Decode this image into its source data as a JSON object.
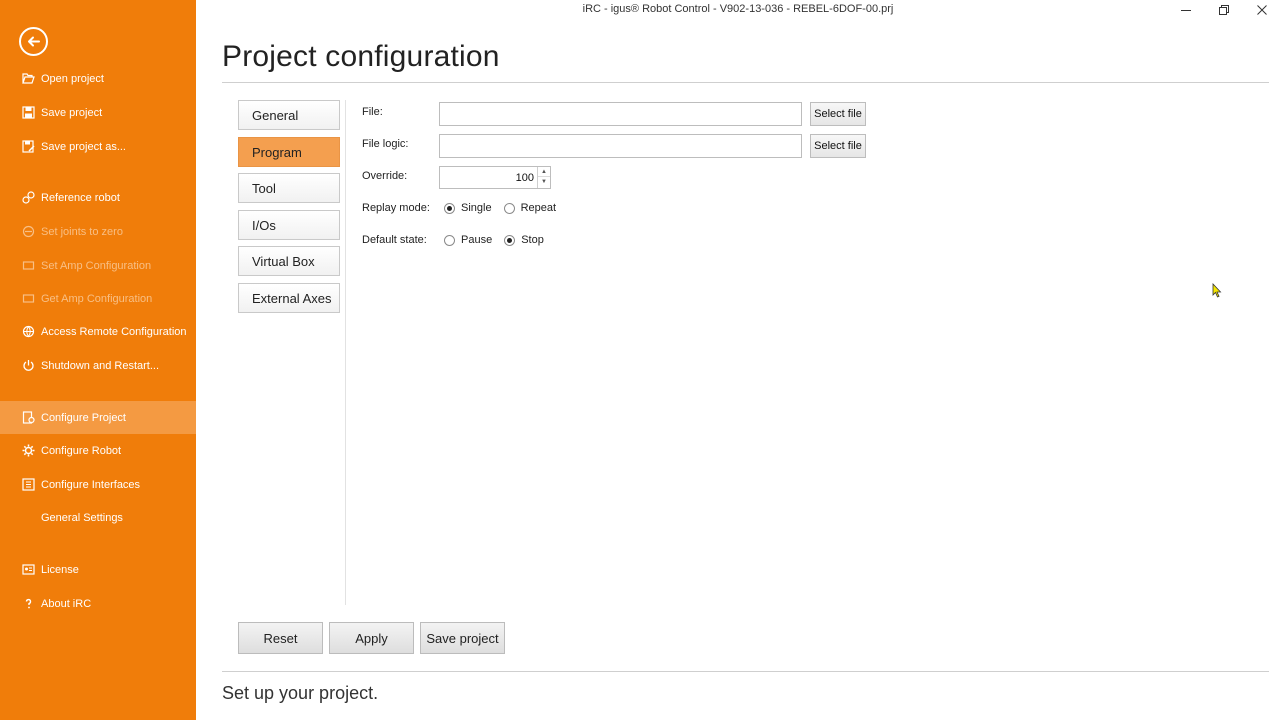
{
  "window": {
    "title": "iRC - igus® Robot Control - V902-13-036 - REBEL-6DOF-00.prj",
    "minimize_icon": "minimize-icon",
    "restore_icon": "restore-icon",
    "close_icon": "close-icon"
  },
  "sidebar": {
    "background": "#f07d0a",
    "back_icon": "back-arrow-icon",
    "items": [
      {
        "label": "Open project",
        "icon": "open-folder-icon",
        "enabled": true
      },
      {
        "label": "Save project",
        "icon": "save-icon",
        "enabled": true
      },
      {
        "label": "Save project as...",
        "icon": "save-as-icon",
        "enabled": true
      },
      {
        "label": "Reference robot",
        "icon": "reference-icon",
        "enabled": true
      },
      {
        "label": "Set joints to zero",
        "icon": "joints-zero-icon",
        "enabled": false
      },
      {
        "label": "Set Amp Configuration",
        "icon": "amp-config-icon",
        "enabled": false
      },
      {
        "label": "Get Amp Configuration",
        "icon": "amp-config-icon",
        "enabled": false
      },
      {
        "label": "Access Remote Configuration",
        "icon": "remote-config-icon",
        "enabled": true
      },
      {
        "label": "Shutdown and Restart...",
        "icon": "power-icon",
        "enabled": true
      },
      {
        "label": "Configure Project",
        "icon": "project-config-icon",
        "enabled": true,
        "active": true
      },
      {
        "label": "Configure Robot",
        "icon": "gear-icon",
        "enabled": true
      },
      {
        "label": "Configure Interfaces",
        "icon": "interfaces-icon",
        "enabled": true
      },
      {
        "label": "General Settings",
        "icon": "",
        "enabled": true
      },
      {
        "label": "License",
        "icon": "license-icon",
        "enabled": true
      },
      {
        "label": "About iRC",
        "icon": "help-icon",
        "enabled": true
      }
    ]
  },
  "main": {
    "title": "Project configuration",
    "tabs": [
      {
        "label": "General",
        "active": false
      },
      {
        "label": "Program",
        "active": true
      },
      {
        "label": "Tool",
        "active": false
      },
      {
        "label": "I/Os",
        "active": false
      },
      {
        "label": "Virtual Box",
        "active": false
      },
      {
        "label": "External Axes",
        "active": false
      }
    ],
    "form": {
      "file_label": "File:",
      "file_value": "",
      "file_logic_label": "File logic:",
      "file_logic_value": "",
      "select_file_label": "Select file",
      "override_label": "Override:",
      "override_value": "100",
      "replay_mode_label": "Replay mode:",
      "replay_options": [
        {
          "label": "Single",
          "checked": true
        },
        {
          "label": "Repeat",
          "checked": false
        }
      ],
      "default_state_label": "Default state:",
      "default_state_options": [
        {
          "label": "Pause",
          "checked": false
        },
        {
          "label": "Stop",
          "checked": true
        }
      ]
    },
    "actions": {
      "reset": "Reset",
      "apply": "Apply",
      "save_project": "Save project"
    },
    "footer": "Set up your project."
  },
  "colors": {
    "accent": "#f07d0a",
    "active_tab": "#f49f4f",
    "sidebar_disabled_text": "#f8bf85"
  }
}
